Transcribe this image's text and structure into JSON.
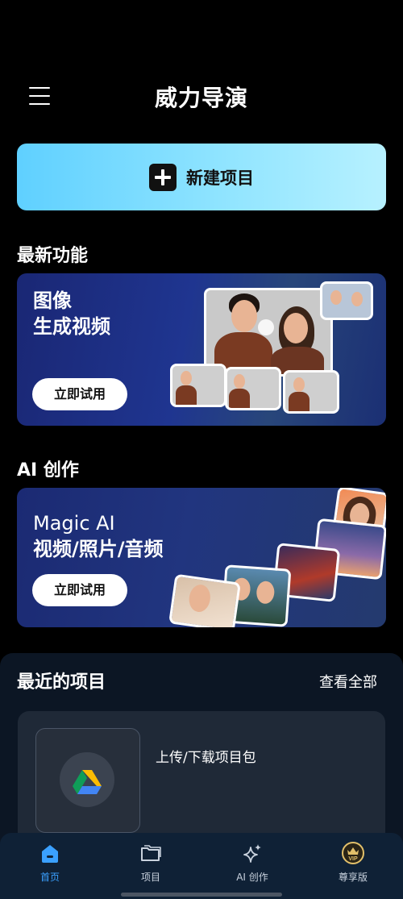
{
  "header": {
    "title": "威力导演"
  },
  "new_project": {
    "label": "新建项目"
  },
  "latest": {
    "title": "最新功能",
    "card": {
      "line1": "图像",
      "line2": "生成视频",
      "button": "立即试用"
    }
  },
  "ai": {
    "title": "AI 创作",
    "card": {
      "line1": "Magic AI",
      "line2": "视频/照片/音频",
      "button": "立即试用"
    }
  },
  "recent": {
    "title": "最近的项目",
    "view_all": "查看全部",
    "upload_label": "上传/下载项目包"
  },
  "nav": [
    {
      "label": "首页",
      "icon": "home-icon",
      "active": true
    },
    {
      "label": "项目",
      "icon": "folder-icon",
      "active": false
    },
    {
      "label": "AI 创作",
      "icon": "sparkle-icon",
      "active": false
    },
    {
      "label": "尊享版",
      "icon": "vip-icon",
      "active": false
    }
  ],
  "colors": {
    "accent": "#3aa0ff",
    "new_project_bg": "#7fdcff",
    "background": "#000000"
  }
}
